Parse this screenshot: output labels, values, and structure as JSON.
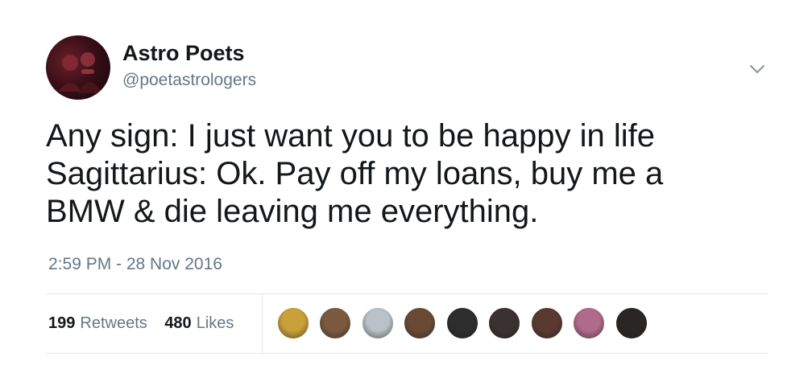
{
  "user": {
    "name": "Astro Poets",
    "handle": "@poetastrologers"
  },
  "tweet": {
    "lines": [
      "Any sign: I just want you to be happy in life",
      "Sagittarius: Ok. Pay off my loans, buy me a",
      "BMW & die leaving me everything."
    ],
    "timestamp": "2:59 PM - 28 Nov 2016"
  },
  "stats": {
    "retweets_count": "199",
    "retweets_label": "Retweets",
    "likes_count": "480",
    "likes_label": "Likes"
  },
  "likers": [
    {
      "avatar_color": "#c9a03a"
    },
    {
      "avatar_color": "#7a5a40"
    },
    {
      "avatar_color": "#b9c2c8"
    },
    {
      "avatar_color": "#6b4a35"
    },
    {
      "avatar_color": "#2e2e2e"
    },
    {
      "avatar_color": "#3a3230"
    },
    {
      "avatar_color": "#5a3a30"
    },
    {
      "avatar_color": "#b06a8a"
    },
    {
      "avatar_color": "#2a2624"
    }
  ],
  "icons": {
    "caret": "chevron-down-icon"
  },
  "colors": {
    "text": "#14171a",
    "secondary": "#657786",
    "divider": "#e1e8ed"
  }
}
